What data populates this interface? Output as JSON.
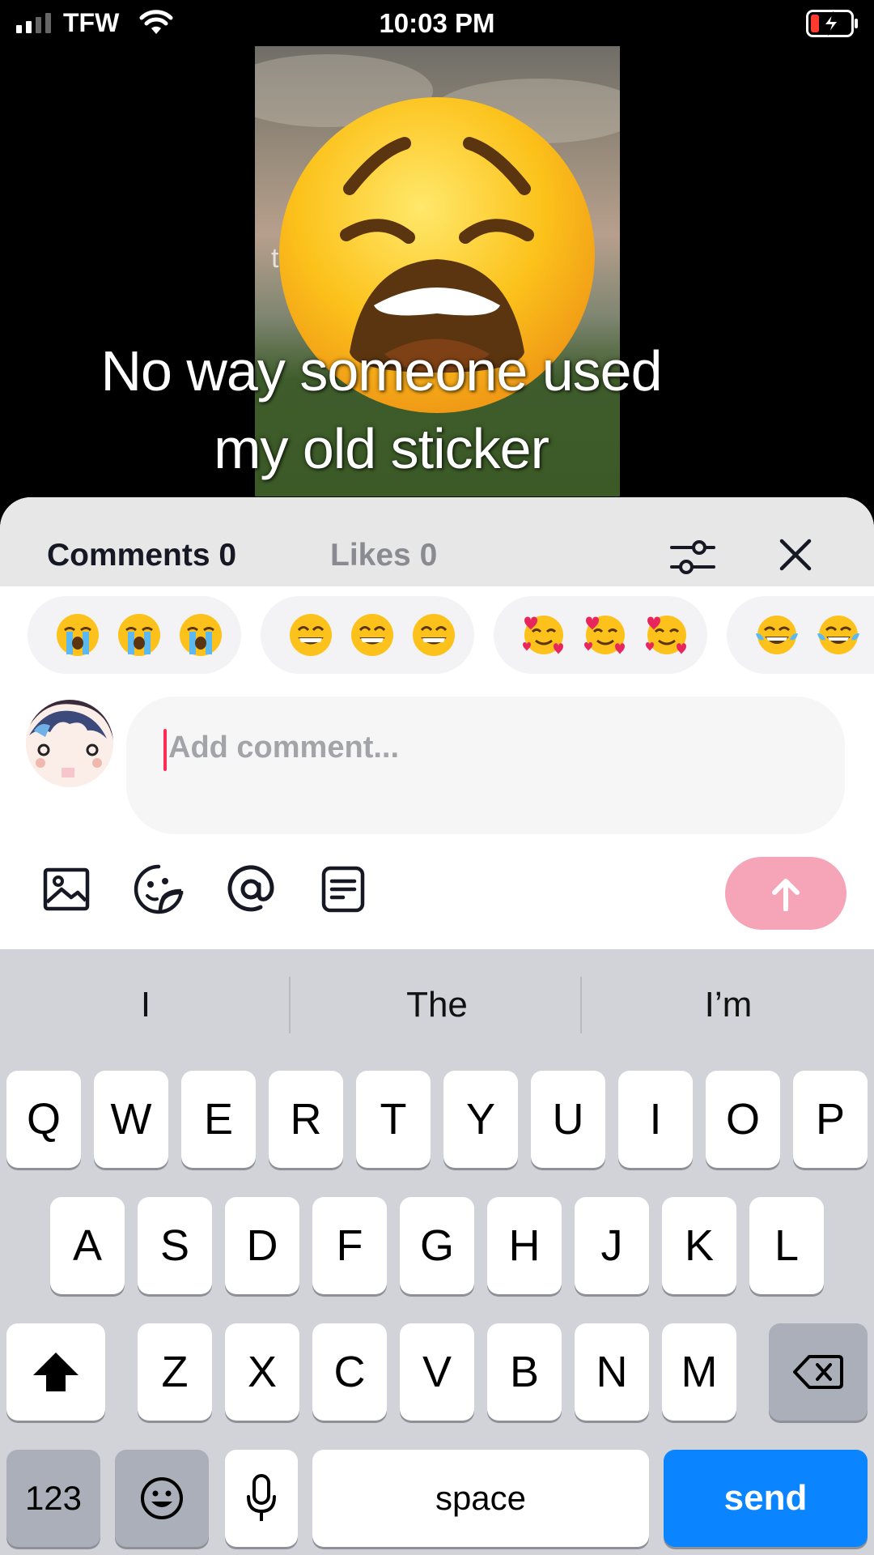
{
  "status": {
    "carrier": "TFW",
    "time": "10:03 PM"
  },
  "video": {
    "caption_line1": "No way someone used",
    "caption_line2": "my old sticker",
    "ghost_letter": "t"
  },
  "sheet": {
    "tab_comments": "Comments 0",
    "tab_likes": "Likes 0",
    "quick_reactions": [
      "loudly-crying-face",
      "grinning-face-with-smiling-eyes",
      "smiling-face-with-hearts",
      "face-with-tears-of-joy"
    ],
    "input_placeholder": "Add comment...",
    "send_button_color": "#f5a5b7",
    "caret_color": "#fe2c55"
  },
  "keyboard": {
    "suggestions": [
      "I",
      "The",
      "I’m"
    ],
    "row1": [
      "Q",
      "W",
      "E",
      "R",
      "T",
      "Y",
      "U",
      "I",
      "O",
      "P"
    ],
    "row2": [
      "A",
      "S",
      "D",
      "F",
      "G",
      "H",
      "J",
      "K",
      "L"
    ],
    "row3": [
      "Z",
      "X",
      "C",
      "V",
      "B",
      "N",
      "M"
    ],
    "numbers_key": "123",
    "space_key": "space",
    "send_key": "send",
    "send_color": "#0a84ff"
  }
}
